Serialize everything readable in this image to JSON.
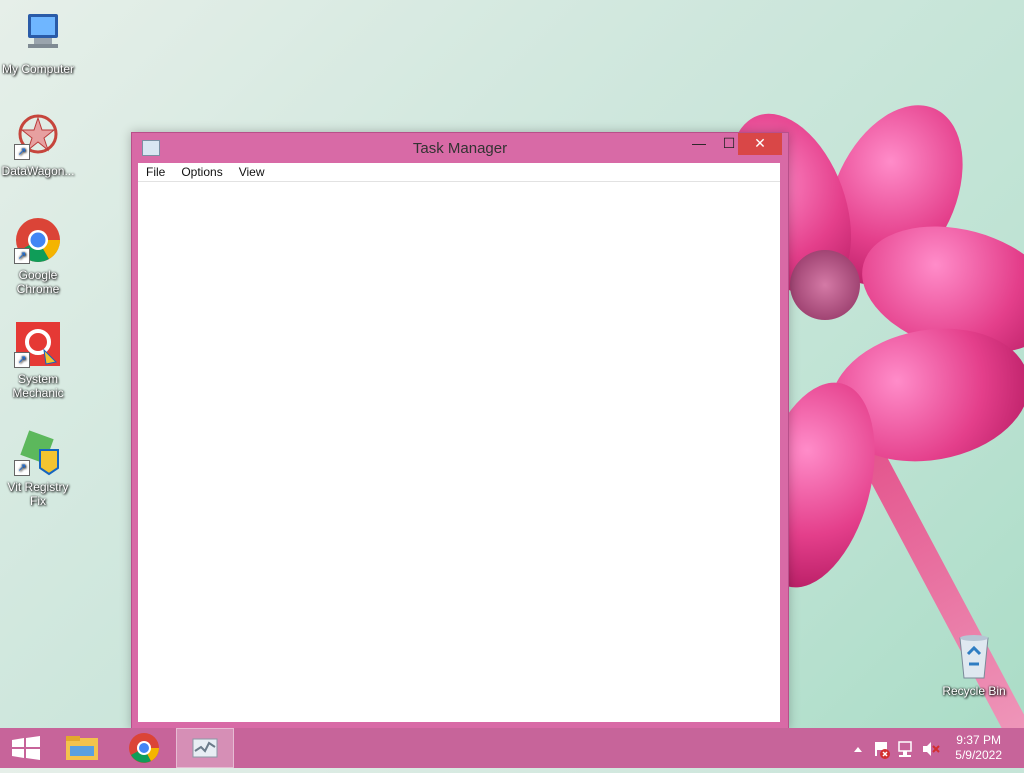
{
  "desktop": {
    "icons": [
      {
        "label": "My Computer"
      },
      {
        "label": "DataWagon..."
      },
      {
        "label": "Google Chrome"
      },
      {
        "label": "System Mechanic"
      },
      {
        "label": "Vit Registry Fix"
      },
      {
        "label": "Recycle Bin"
      }
    ]
  },
  "window": {
    "title": "Task Manager",
    "controls": {
      "minimize": "—",
      "maximize": "☐",
      "close": "✕"
    },
    "menu": [
      "File",
      "Options",
      "View"
    ]
  },
  "taskbar": {
    "apps": [
      "start",
      "file-explorer",
      "google-chrome",
      "task-manager"
    ],
    "tray_icons": [
      "show-hidden-icons",
      "action-center-flag",
      "network",
      "volume-muted"
    ],
    "time": "9:37 PM",
    "date": "5/9/2022"
  }
}
